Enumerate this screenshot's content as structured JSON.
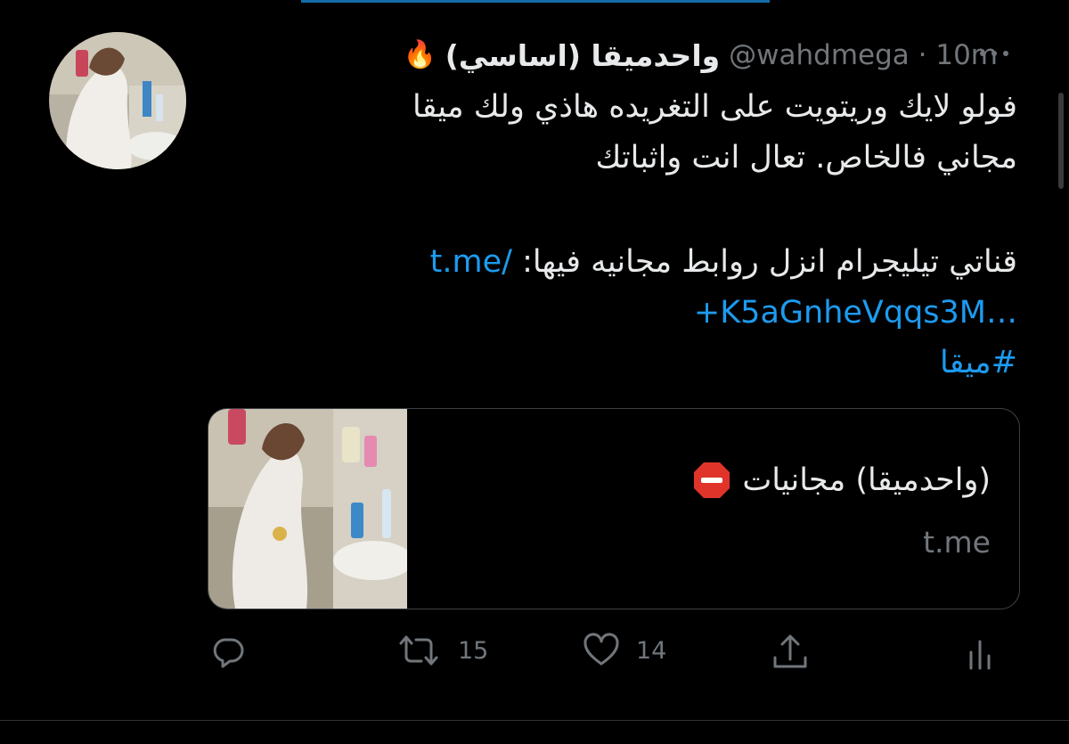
{
  "tweet": {
    "display_name": "واحدميقا (اساسي)",
    "flame_icon": "fire-emoji",
    "handle_time": "@wahdmega · 10m",
    "text_lines": [
      "فولو لايك وريتويت على التغريده هاذي ولك ميقا",
      "مجاني فالخاص. تعال انت واثباتك",
      "قناتي تيليجرام انزل روابط مجانيه فيها:"
    ],
    "link_part1": "t.me/",
    "link_part2": "+K5aGnheVqqs3M…",
    "hashtag": "#ميقا"
  },
  "card": {
    "title": "(واحدميقا) مجانيات",
    "title_icon": "stop-sign-emoji",
    "domain": "t.me"
  },
  "actions": {
    "reply_icon": "reply-icon",
    "retweet_icon": "retweet-icon",
    "retweet_count": "15",
    "like_icon": "heart-icon",
    "like_count": "14",
    "share_icon": "share-icon",
    "analytics_icon": "analytics-icon"
  },
  "colors": {
    "background": "#000000",
    "link": "#1d9bf0",
    "secondary": "#71767b",
    "text": "#e7e9ea"
  }
}
